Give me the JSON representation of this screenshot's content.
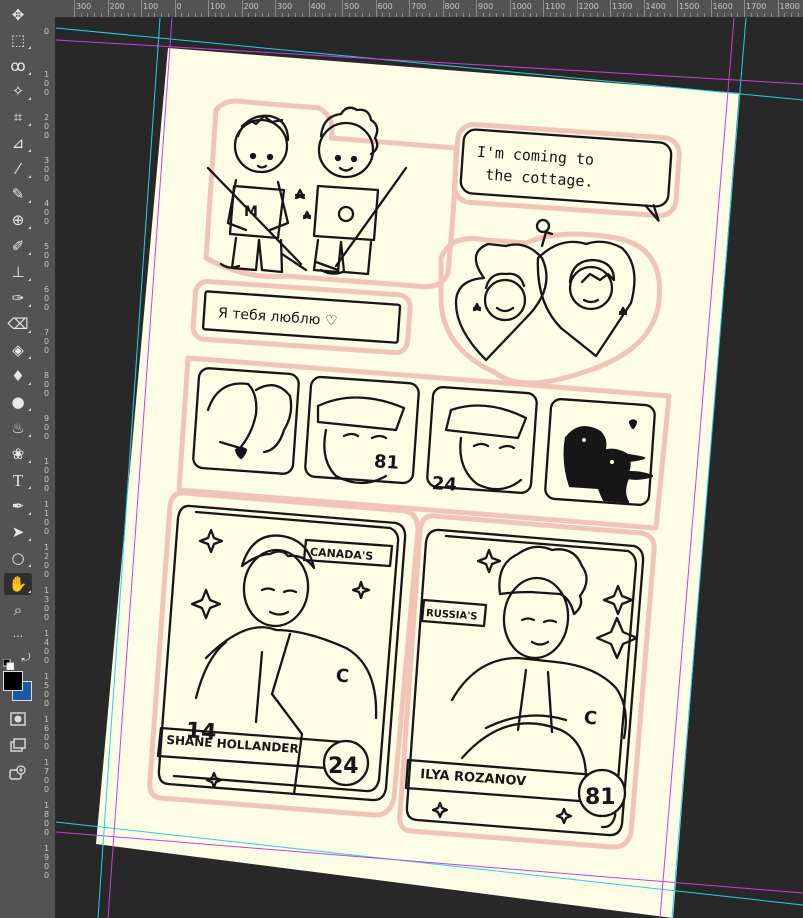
{
  "ruler": {
    "top_labels": [
      "300",
      "200",
      "100",
      "0",
      "100",
      "200",
      "300",
      "400",
      "500",
      "600",
      "700",
      "800",
      "900",
      "1000",
      "1100",
      "1200",
      "1300",
      "1400",
      "1500",
      "1600",
      "1700",
      "1800"
    ],
    "left_labels": [
      "0",
      "1\n0\n0",
      "2\n0\n0",
      "3\n0\n0",
      "4\n0\n0",
      "5\n0\n0",
      "6\n0\n0",
      "7\n0\n0",
      "8\n0\n0",
      "9\n0\n0",
      "1\n0\n0\n0",
      "1\n1\n0\n0",
      "1\n2\n0\n0",
      "1\n3\n0\n0",
      "1\n4\n0\n0",
      "1\n5\n0\n0",
      "1\n6\n0\n0",
      "1\n7\n0\n0",
      "1\n8\n0\n0",
      "1\n9\n0\n0"
    ]
  },
  "tools": [
    {
      "icon": "✥"
    },
    {
      "icon": "⬚"
    },
    {
      "icon": "ꝏ"
    },
    {
      "icon": "✧"
    },
    {
      "icon": "⌗"
    },
    {
      "icon": "⊿"
    },
    {
      "icon": "⁄"
    },
    {
      "icon": "✎"
    },
    {
      "icon": "⊕"
    },
    {
      "icon": "✐"
    },
    {
      "icon": "⊥"
    },
    {
      "icon": "✑"
    },
    {
      "icon": "⌫"
    },
    {
      "icon": "◈"
    },
    {
      "icon": "♦"
    },
    {
      "icon": "●"
    },
    {
      "icon": "♨"
    },
    {
      "icon": "❀"
    },
    {
      "icon": "T"
    },
    {
      "icon": "✒"
    },
    {
      "icon": "➤"
    },
    {
      "icon": "○"
    },
    {
      "icon": "✋"
    },
    {
      "icon": "⌕"
    },
    {
      "icon": "···"
    }
  ],
  "colors": {
    "foreground": "#000000",
    "background": "#1b59a8",
    "paper": "#fdfde6",
    "sticker_outline": "#f2c4b8",
    "guide_cyan": "#22d3e6",
    "guide_magenta": "#d23cd8"
  },
  "document": {
    "speech_bubble": "I'm coming to the cottage.",
    "russian_label": "Я тебя люблю ♡",
    "panel_2_number": "81",
    "panel_3_number": "24",
    "card_left": {
      "banner_top": "CANADA'S",
      "name": "SHANE HOLLANDER",
      "number": "24",
      "sleeve_number": "14",
      "letter": "C"
    },
    "card_right": {
      "banner_top": "RUSSIA'S",
      "name": "ILYA ROZANOV",
      "number": "81",
      "letter": "C"
    },
    "jersey_letter": "M"
  }
}
